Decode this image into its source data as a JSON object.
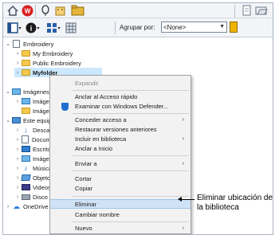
{
  "toolbar": {
    "icons": [
      "home-icon",
      "wilcom-logo-icon",
      "balloon-pin-icon",
      "building-icon",
      "folder-icon",
      "document-icon",
      "open-folder-icon"
    ],
    "row2_icons": [
      "view-panel-icon",
      "info-icon",
      "thumbnail-view-icon",
      "grid-view-icon"
    ],
    "group_label": "Agrupar por:",
    "group_value": "<None>"
  },
  "tree": {
    "embroidery": "Embroidery",
    "my_embroidery": "My Embroidery",
    "public_embroidery": "Public Embroidery",
    "myfolder": "Myfolder",
    "imagenes": "Imágenes",
    "imagenes_sub1": "Imágenes",
    "imagenes_sub2": "Imágenes",
    "este_equipo": "Este equipo",
    "descargas": "Descarga",
    "documentos": "Documen",
    "escritorio": "Escritorio",
    "imagenes_pc": "Imágenes",
    "musica": "Música",
    "objetos3d": "Objetos 3",
    "videos": "Videos",
    "disco_local": "Disco loc",
    "onedrive": "OneDrive"
  },
  "menu": {
    "expandir": "Expandir",
    "anclar_rapido": "Anclar al Acceso rápido",
    "examinar_defender": "Examinar con Windows Defender...",
    "conceder_acceso": "Conceder acceso a",
    "restaurar_versiones": "Restaurar versiones anteriores",
    "incluir_biblioteca": "Incluir en biblioteca",
    "anclar_inicio": "Anclar a Inicio",
    "enviar_a": "Enviar a",
    "cortar": "Cortar",
    "copiar": "Copiar",
    "eliminar": "Eliminar",
    "cambiar_nombre": "Cambiar nombre",
    "nuevo": "Nuevo"
  },
  "callout": {
    "text": "Eliminar ubicación de la biblioteca"
  },
  "colors": {
    "selection": "#cce8ff",
    "menu_highlight": "#cfe3f7",
    "folder": "#f5c84a"
  }
}
